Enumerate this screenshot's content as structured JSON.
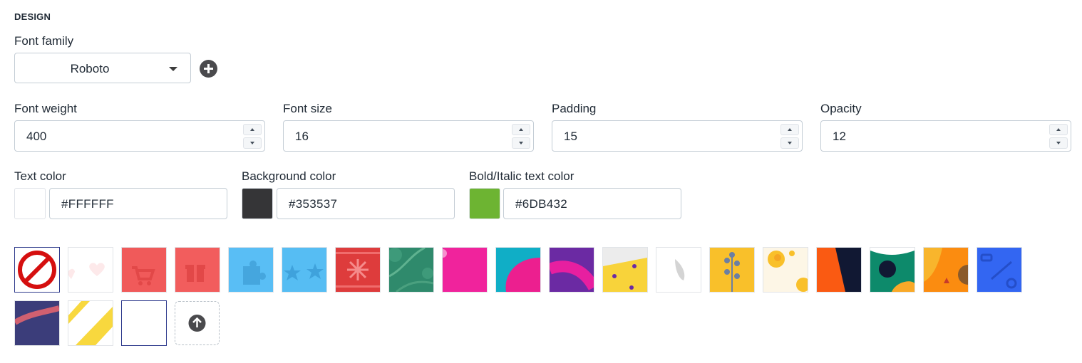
{
  "section_title": "DESIGN",
  "font_family": {
    "label": "Font family",
    "value": "Roboto"
  },
  "icons": {
    "add": "plus-circle-icon",
    "upload": "arrow-up-circle-icon",
    "dropdown": "caret-down-icon",
    "none": "no-pattern-icon"
  },
  "font_weight": {
    "label": "Font weight",
    "value": "400"
  },
  "font_size": {
    "label": "Font size",
    "value": "16"
  },
  "padding": {
    "label": "Padding",
    "value": "15"
  },
  "opacity": {
    "label": "Opacity",
    "value": "12"
  },
  "text_color": {
    "label": "Text color",
    "value": "#FFFFFF",
    "swatch": "#FFFFFF"
  },
  "background_color": {
    "label": "Background color",
    "value": "#353537",
    "swatch": "#353537"
  },
  "bold_italic_color": {
    "label": "Bold/Italic text color",
    "value": "#6DB432",
    "swatch": "#6DB432"
  },
  "patterns": [
    "none",
    "hearts",
    "cart",
    "gift",
    "puzzle",
    "stars",
    "snowflake",
    "leaves",
    "pink-blob",
    "cyan-magenta-arc",
    "purple-magenta-arc",
    "yellow-dots",
    "white-leaf",
    "yellow-flowers",
    "orange-flowers",
    "orange-navy-diagonal",
    "green-navy-shapes",
    "orange-shapes",
    "blue-tools",
    "navy-stripe",
    "yellow-diagonal",
    "blank-white"
  ],
  "selected_pattern": "none"
}
